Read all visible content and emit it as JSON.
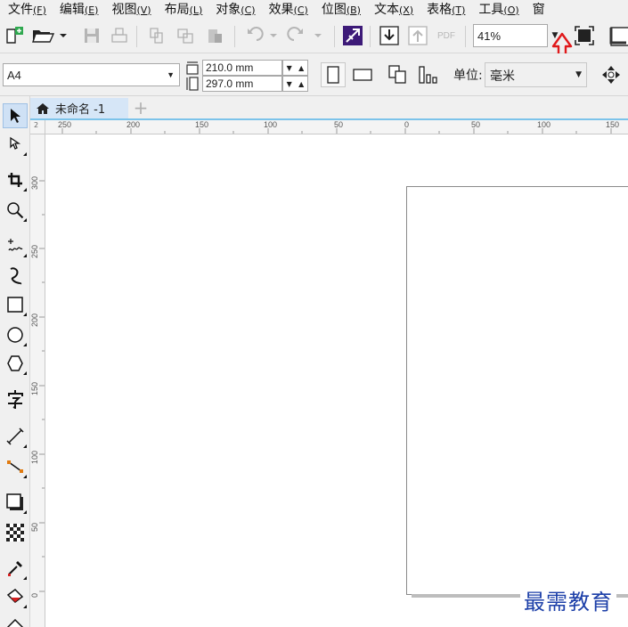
{
  "menubar": {
    "items": [
      {
        "label": "文件",
        "mnemonic": "(F)"
      },
      {
        "label": "编辑",
        "mnemonic": "(E)"
      },
      {
        "label": "视图",
        "mnemonic": "(V)"
      },
      {
        "label": "布局",
        "mnemonic": "(L)"
      },
      {
        "label": "对象",
        "mnemonic": "(C)"
      },
      {
        "label": "效果",
        "mnemonic": "(C)"
      },
      {
        "label": "位图",
        "mnemonic": "(B)"
      },
      {
        "label": "文本",
        "mnemonic": "(X)"
      },
      {
        "label": "表格",
        "mnemonic": "(T)"
      },
      {
        "label": "工具",
        "mnemonic": "(O)"
      },
      {
        "label": "窗",
        "mnemonic": ""
      }
    ]
  },
  "toolbar": {
    "zoom_value": "41%",
    "pdf_label": "PDF"
  },
  "propbar": {
    "page_size": "A4",
    "width_value": "210.0 mm",
    "height_value": "297.0 mm",
    "unit_label": "单位:",
    "unit_value": "毫米"
  },
  "document_tab": {
    "title": "未命名 -1"
  },
  "rulers": {
    "horizontal": [
      "250",
      "200",
      "150",
      "100",
      "50",
      "0",
      "50",
      "100",
      "150"
    ],
    "vertical": [
      "300",
      "250",
      "200",
      "150",
      "100",
      "50",
      "0"
    ],
    "corner": "2"
  },
  "watermark": "最需教育",
  "colors": {
    "accent_tab": "#d6e6f7",
    "tab_underline": "#7cc3ea",
    "annotation_arrow": "#e0191b",
    "watermark": "#1c3fa8"
  },
  "icons": [
    "new-document-icon",
    "open-folder-icon",
    "save-icon",
    "print-icon",
    "undo-icon",
    "redo-icon",
    "import-icon",
    "export-icon",
    "pdf-icon",
    "fullscreen-icon"
  ]
}
